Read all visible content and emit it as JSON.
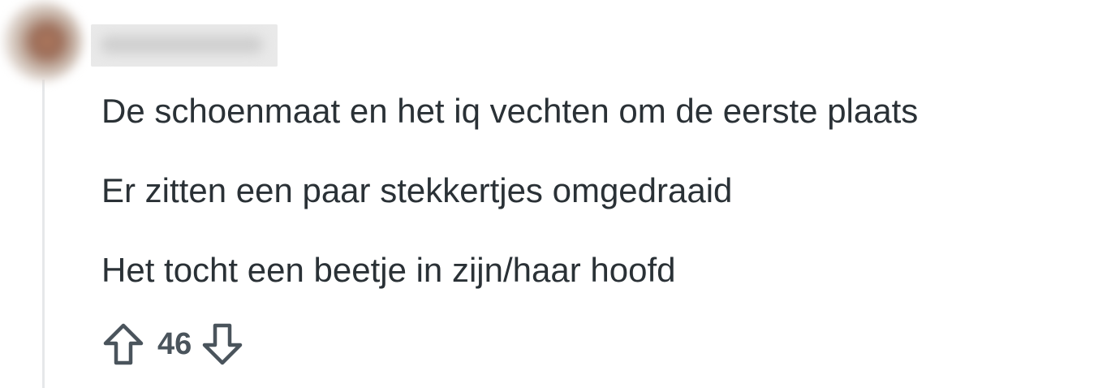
{
  "comment": {
    "body_lines": [
      "De schoenmaat en het iq vechten om de eerste plaats",
      "Er zitten een paar stekkertjes omgedraaid",
      "Het tocht een beetje in zijn/haar hoofd"
    ],
    "score": "46",
    "upvote_icon": "arrow-up-outline-icon",
    "downvote_icon": "arrow-down-outline-icon",
    "text_color": "#2a3136",
    "score_color": "#4a545c",
    "thread_line_color": "#e6e8ea"
  }
}
